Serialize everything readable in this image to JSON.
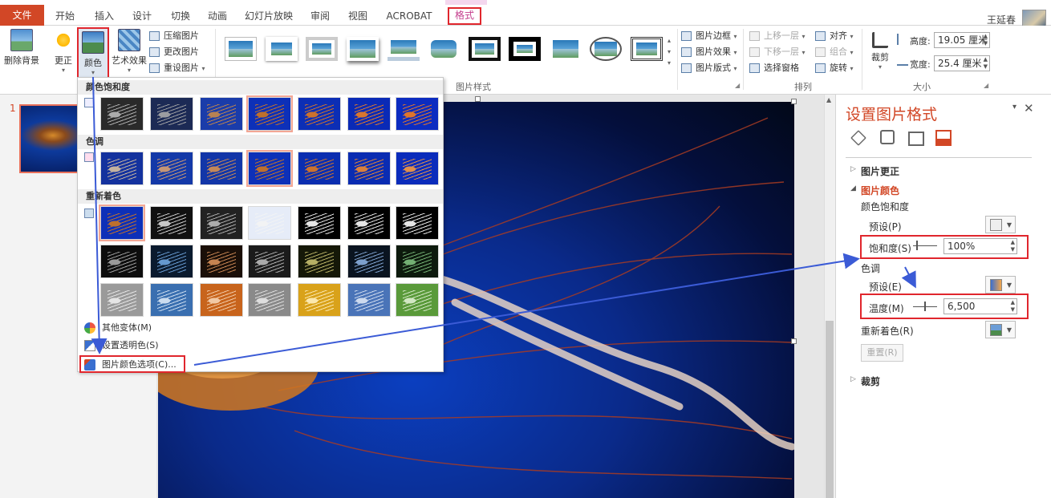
{
  "tabs": {
    "file": "文件",
    "home": "开始",
    "insert": "插入",
    "design": "设计",
    "transitions": "切换",
    "animations": "动画",
    "slideshow": "幻灯片放映",
    "review": "审阅",
    "view": "视图",
    "acrobat": "ACROBAT",
    "format": "格式"
  },
  "user": {
    "name": "王延春"
  },
  "ribbon": {
    "remove_bg": "删除背景",
    "corrections": "更正",
    "color": "颜色",
    "artistic": "艺术效果",
    "compress": "压缩图片",
    "change_pic": "更改图片",
    "reset_pic": "重设图片",
    "styles_group": "图片样式",
    "border": "图片边框",
    "effects": "图片效果",
    "layout": "图片版式",
    "bring_forward": "上移一层",
    "send_backward": "下移一层",
    "selection_pane": "选择窗格",
    "align": "对齐",
    "group": "组合",
    "rotate": "旋转",
    "arrange_group": "排列",
    "crop": "裁剪",
    "height_label": "高度:",
    "height_value": "19.05 厘米",
    "width_label": "宽度:",
    "width_value": "25.4 厘米",
    "size_group": "大小"
  },
  "slides": {
    "number": "1"
  },
  "menu": {
    "saturation_header": "颜色饱和度",
    "tone_header": "色调",
    "recolor_header": "重新着色",
    "more_variations": "其他变体(M)",
    "set_transparent": "设置透明色(S)",
    "color_options": "图片颜色选项(C)..."
  },
  "format_pane": {
    "title": "设置图片格式",
    "picture_corrections": "图片更正",
    "picture_color": "图片颜色",
    "color_saturation": "颜色饱和度",
    "presets_p": "预设(P)",
    "saturation_label": "饱和度(S)",
    "saturation_value": "100%",
    "tone": "色调",
    "presets_e": "预设(E)",
    "temperature_label": "温度(M)",
    "temperature_value": "6,500",
    "recolor": "重新着色(R)",
    "reset": "重置(R)",
    "crop": "裁剪"
  },
  "colors": {
    "accent": "#d24726",
    "highlight": "#e0262d",
    "arrow": "#3b5bd6"
  }
}
